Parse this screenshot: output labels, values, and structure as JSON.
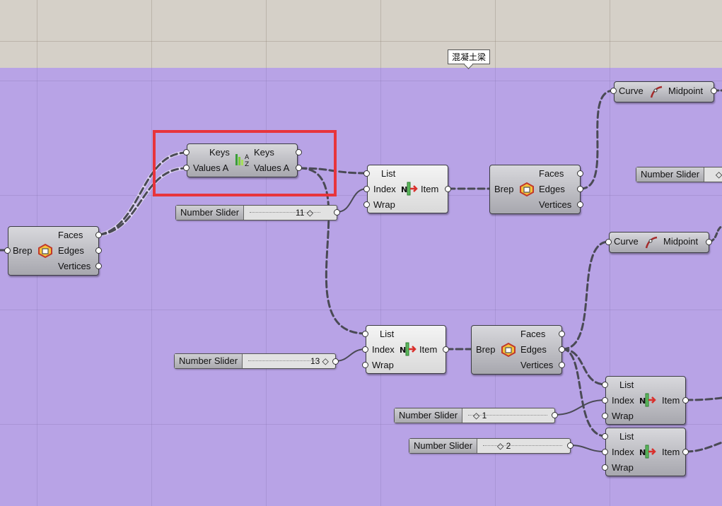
{
  "group_label": "混凝土梁",
  "colors": {
    "canvas": "#b8a3e6",
    "header": "#d5d0c8",
    "highlight": "#e8343c",
    "wire": "#4a4a55"
  },
  "components": {
    "brep_left": {
      "input": "Brep",
      "outputs": [
        "Faces",
        "Edges",
        "Vertices"
      ],
      "icon": "brep-deconstruct-icon"
    },
    "sort": {
      "inputs": [
        "Keys",
        "Values A"
      ],
      "outputs": [
        "Keys",
        "Values A"
      ],
      "icon": "sort-list-icon"
    },
    "list1": {
      "inputs": [
        "List",
        "Index",
        "Wrap"
      ],
      "output": "Item",
      "icon": "list-item-icon"
    },
    "brep_mid1": {
      "input": "Brep",
      "outputs": [
        "Faces",
        "Edges",
        "Vertices"
      ],
      "icon": "brep-deconstruct-icon"
    },
    "curve1": {
      "input": "Curve",
      "output": "Midpoint",
      "icon": "curve-midpoint-icon"
    },
    "curve2": {
      "input": "Curve",
      "output": "Midpoint",
      "icon": "curve-midpoint-icon"
    },
    "list2": {
      "inputs": [
        "List",
        "Index",
        "Wrap"
      ],
      "output": "Item",
      "icon": "list-item-icon"
    },
    "brep_mid2": {
      "input": "Brep",
      "outputs": [
        "Faces",
        "Edges",
        "Vertices"
      ],
      "icon": "brep-deconstruct-icon"
    },
    "list3": {
      "inputs": [
        "List",
        "Index",
        "Wrap"
      ],
      "output": "Item",
      "icon": "list-item-icon"
    },
    "list4": {
      "inputs": [
        "List",
        "Index",
        "Wrap"
      ],
      "output": "Item",
      "icon": "list-item-icon"
    }
  },
  "sliders": [
    {
      "name": "Number Slider",
      "value": "11 ◇"
    },
    {
      "name": "Number Slider",
      "value": "13 ◇"
    },
    {
      "name": "Number Slider",
      "value": "◇ 1"
    },
    {
      "name": "Number Slider",
      "value": "◇ 2"
    },
    {
      "name": "Number Slider",
      "value": "◇"
    }
  ]
}
